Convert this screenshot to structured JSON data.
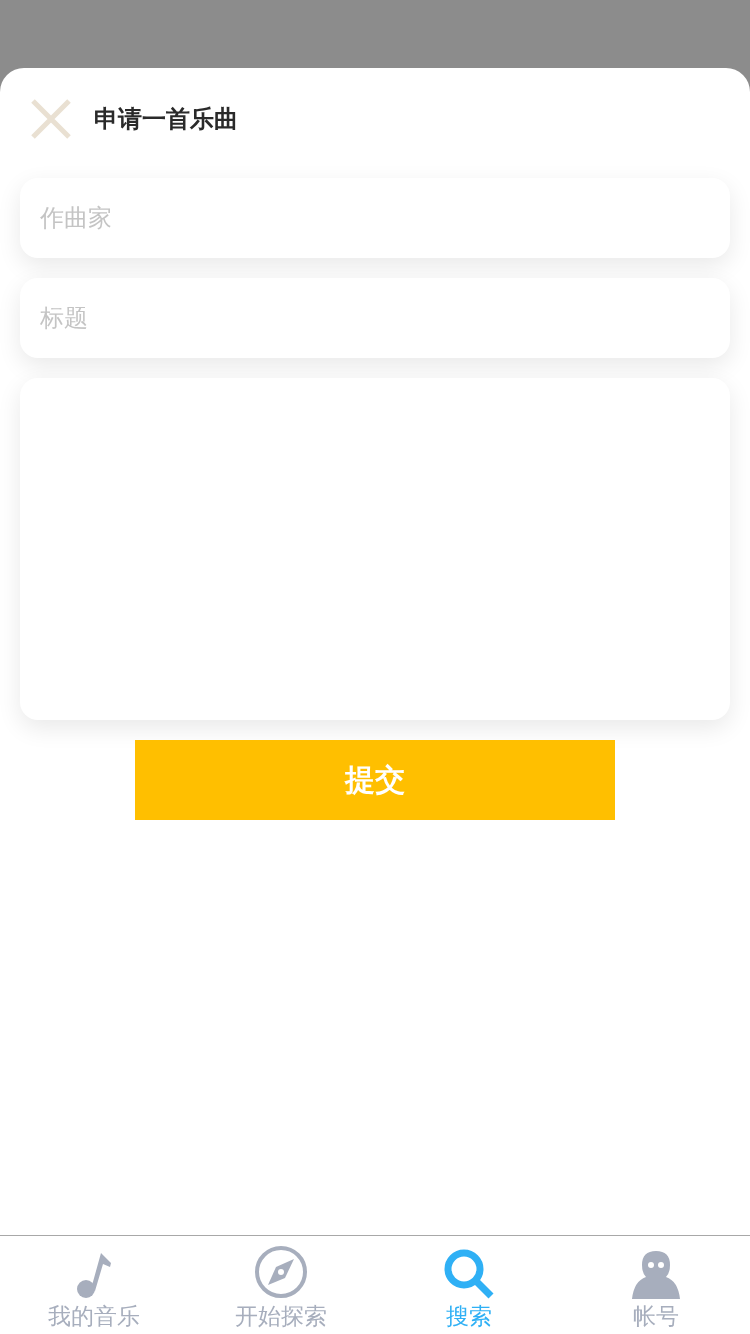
{
  "dialog": {
    "title": "申请一首乐曲"
  },
  "fields": [
    {
      "kind": "input",
      "placeholder": "作曲家"
    },
    {
      "kind": "input",
      "placeholder": "标题"
    },
    {
      "kind": "textarea"
    }
  ],
  "submit_button": "提交",
  "tab_bar": [
    {
      "label": "我的音乐",
      "selected": false
    },
    {
      "label": "开始探索",
      "selected": false
    },
    {
      "label": "搜索",
      "selected": true
    },
    {
      "label": "帐号",
      "selected": false
    }
  ]
}
